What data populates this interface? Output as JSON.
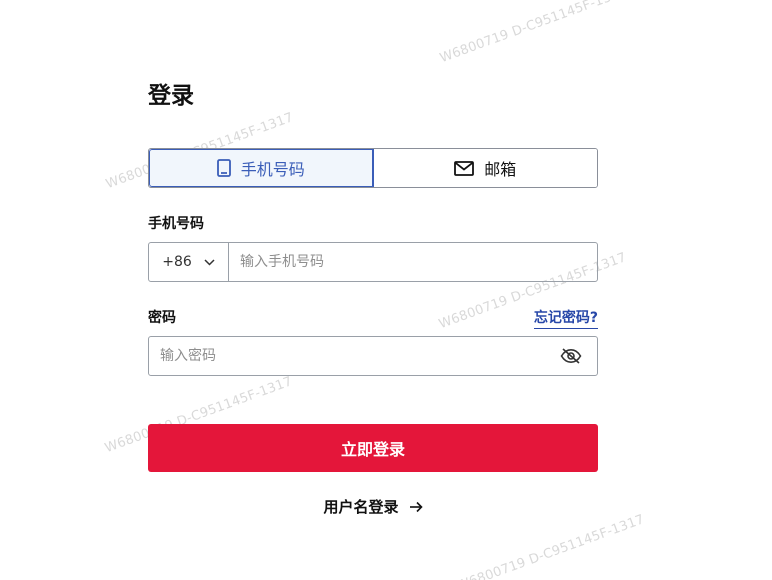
{
  "watermark": "W6800719 D-C951145F-1317",
  "login": {
    "title": "登录",
    "tabs": [
      {
        "label": "手机号码",
        "icon": "phone-icon",
        "active": true
      },
      {
        "label": "邮箱",
        "icon": "mail-icon",
        "active": false
      }
    ],
    "phone": {
      "label": "手机号码",
      "country_code": "+86",
      "placeholder": "输入手机号码",
      "value": ""
    },
    "password": {
      "label": "密码",
      "placeholder": "输入密码",
      "value": "",
      "forgot_label": "忘记密码?",
      "visibility_icon": "eye-off-icon"
    },
    "submit_label": "立即登录",
    "alt_login_label": "用户名登录",
    "alt_login_icon": "arrow-right-icon"
  },
  "colors": {
    "primary": "#e4163a",
    "tab_active_text": "#3a5db8",
    "tab_active_bg": "#f1f6fc",
    "link": "#2747a8"
  }
}
